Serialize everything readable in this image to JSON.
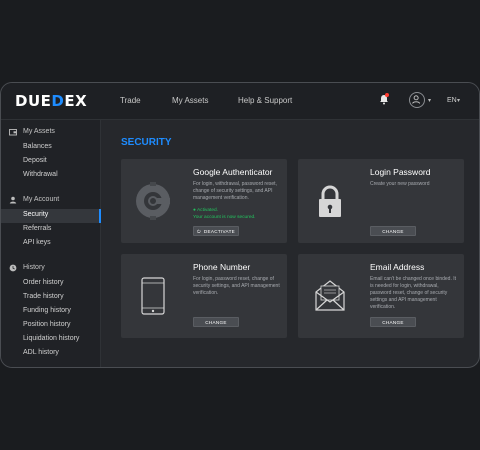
{
  "header": {
    "logo": {
      "prefix": "DUE",
      "mid": "D",
      "suffix": "EX"
    },
    "nav": [
      "Trade",
      "My Assets",
      "Help & Support"
    ],
    "lang": "EN",
    "accent_color": "#1e8cff"
  },
  "sidebar": {
    "sections": [
      {
        "title": "My Assets",
        "icon": "wallet-icon",
        "items": [
          "Balances",
          "Deposit",
          "Withdrawal"
        ]
      },
      {
        "title": "My Account",
        "icon": "user-icon",
        "items": [
          "Security",
          "Referrals",
          "API keys"
        ]
      },
      {
        "title": "History",
        "icon": "clock-icon",
        "items": [
          "Order history",
          "Trade history",
          "Funding history",
          "Position history",
          "Liquidation history",
          "ADL history"
        ]
      }
    ],
    "active_item": "Security"
  },
  "main": {
    "title": "SECURITY",
    "cards": [
      {
        "title": "Google Authenticator",
        "description": "For login, withdrawal, password reset, change of security settings, and API management verification.",
        "status": "Activated.",
        "status_note": "Your account is now secured.",
        "button": "DEACTIVATE",
        "icon": "google-authenticator-icon"
      },
      {
        "title": "Login Password",
        "description": "Create your new password",
        "button": "CHANGE",
        "icon": "lock-icon"
      },
      {
        "title": "Phone Number",
        "description": "For login, password reset, change of security settings, and API management verification.",
        "button": "CHANGE",
        "icon": "phone-icon"
      },
      {
        "title": "Email Address",
        "description": "Email can't be changed once binded. It is needed for login, withdrawal, password reset, change of security settings and API management verification.",
        "button": "CHANGE",
        "icon": "envelope-icon"
      }
    ]
  }
}
